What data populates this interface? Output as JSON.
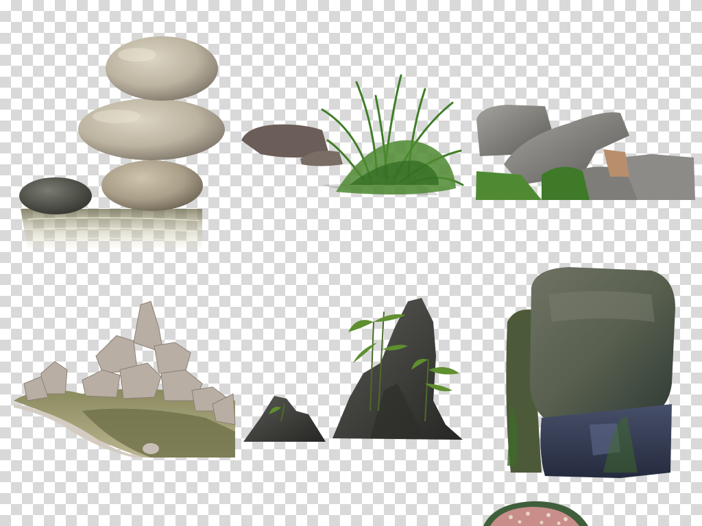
{
  "background": {
    "pattern": "transparency-checkerboard",
    "colors": [
      "#ffffff",
      "#d9d9d9"
    ]
  },
  "objects": [
    {
      "name": "stacked-pebbles-with-reflection",
      "main_color": "#c9c0aa"
    },
    {
      "name": "rocks-with-grass-tuft",
      "main_color": "#4d8a2e"
    },
    {
      "name": "grey-boulder-pile",
      "main_color": "#8d8b88"
    },
    {
      "name": "rockery-pond",
      "main_color": "#b9aea3"
    },
    {
      "name": "dark-rock-peaks-with-bamboo",
      "main_color": "#3f3f3c"
    },
    {
      "name": "mossy-large-boulder",
      "main_color": "#5f6458"
    },
    {
      "name": "mosaic-stone-partial",
      "main_color": "#c98d8a"
    }
  ]
}
